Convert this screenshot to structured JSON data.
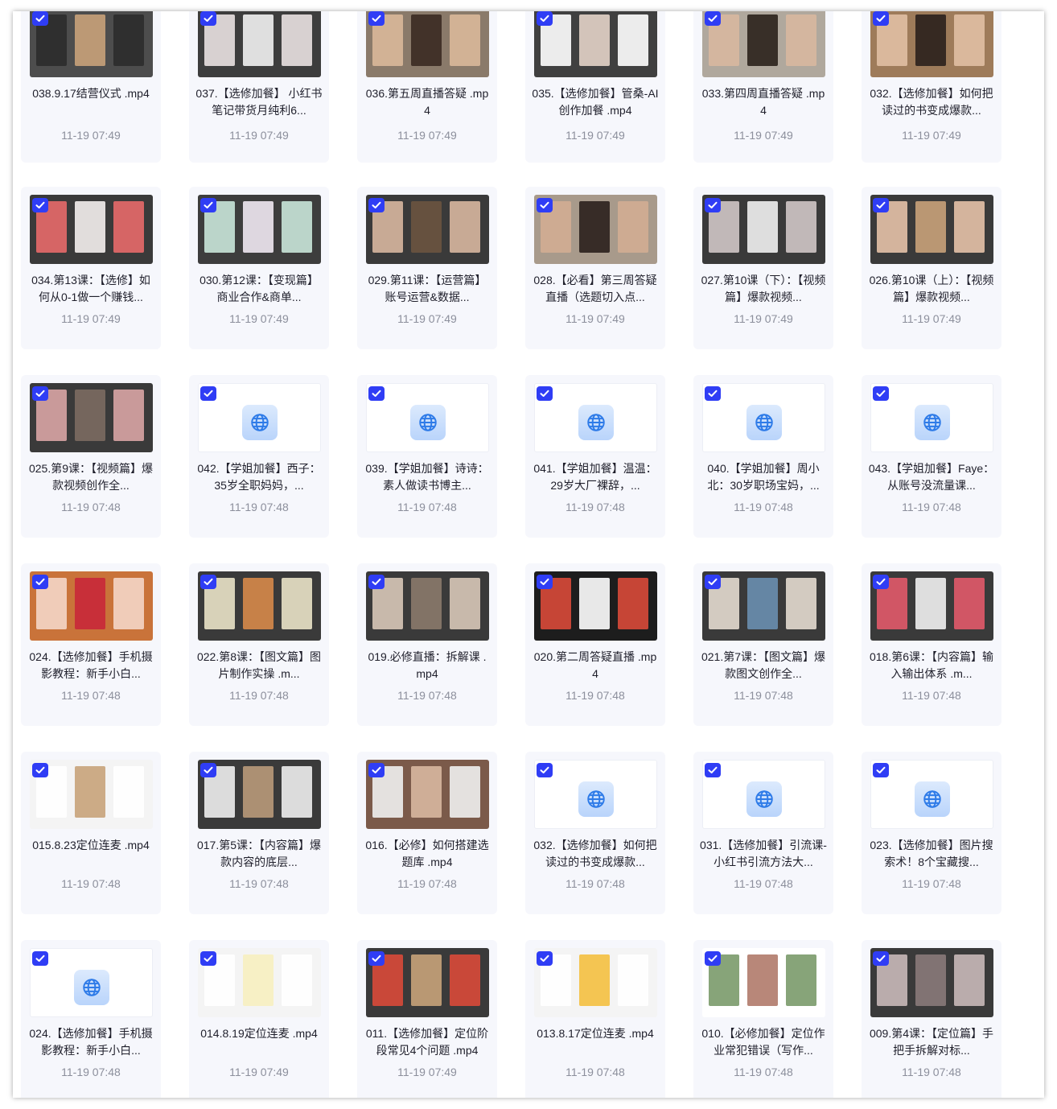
{
  "files": [
    {
      "title": "038.9.17结营仪式 .mp4",
      "time": "11-19 07:49",
      "kind": "video",
      "palette": [
        "#4d4d4d",
        "#c9a27a",
        "#2c2c2c"
      ]
    },
    {
      "title": "037.【选修加餐】 小红书笔记带货月纯利6...",
      "time": "11-19 07:49",
      "kind": "video",
      "palette": [
        "#3d3d3d",
        "#f1f1f1",
        "#e9e1e1"
      ]
    },
    {
      "title": "036.第五周直播答疑 .mp4",
      "time": "11-19 07:49",
      "kind": "video",
      "palette": [
        "#8a7a6a",
        "#3a2a22",
        "#d9b89a"
      ]
    },
    {
      "title": "035.【选修加餐】管桑-AI创作加餐 .mp4",
      "time": "11-19 07:49",
      "kind": "video",
      "palette": [
        "#404040",
        "#e3d3c8",
        "#ffffff"
      ]
    },
    {
      "title": "033.第四周直播答疑 .mp4",
      "time": "11-19 07:49",
      "kind": "video",
      "palette": [
        "#b0a89d",
        "#2b211c",
        "#d8b7a0"
      ]
    },
    {
      "title": "032.【选修加餐】如何把读过的书变成爆款...",
      "time": "11-19 07:49",
      "kind": "video",
      "palette": [
        "#9e7b5a",
        "#2a201c",
        "#e0bfa3"
      ]
    },
    {
      "title": "034.第13课：【选修】如何从0-1做一个赚钱...",
      "time": "11-19 07:49",
      "kind": "video",
      "palette": [
        "#3a3a3a",
        "#f4f0ee",
        "#e86a6a"
      ]
    },
    {
      "title": "030.第12课：【变现篇】商业合作&商单...",
      "time": "11-19 07:49",
      "kind": "video",
      "palette": [
        "#3d3d3d",
        "#f0e8f2",
        "#c9e6d9"
      ]
    },
    {
      "title": "029.第11课：【运营篇】账号运营&数据...",
      "time": "11-19 07:49",
      "kind": "video",
      "palette": [
        "#3a3a3a",
        "#6b5440",
        "#d8b7a0"
      ]
    },
    {
      "title": "028.【必看】第三周答疑直播（选题切入点...",
      "time": "11-19 07:49",
      "kind": "video",
      "palette": [
        "#a89a8b",
        "#2a201c",
        "#d2ad92"
      ]
    },
    {
      "title": "027.第10课（下）：【视频篇】爆款视频...",
      "time": "11-19 07:49",
      "kind": "video",
      "palette": [
        "#3a3a3a",
        "#f1f1f1",
        "#d0c6c6"
      ]
    },
    {
      "title": "026.第10课（上）：【视频篇】爆款视频...",
      "time": "11-19 07:49",
      "kind": "video",
      "palette": [
        "#3a3a3a",
        "#c9a27a",
        "#e5c2a8"
      ]
    },
    {
      "title": "025.第9课：【视频篇】爆款视频创作全...",
      "time": "11-19 07:48",
      "kind": "video",
      "palette": [
        "#3a3a3a",
        "#7c6b62",
        "#d9a5a5"
      ]
    },
    {
      "title": "042.【学姐加餐】西子：35岁全职妈妈，...",
      "time": "11-19 07:48",
      "kind": "link"
    },
    {
      "title": "039.【学姐加餐】诗诗：素人做读书博主...",
      "time": "11-19 07:48",
      "kind": "link"
    },
    {
      "title": "041.【学姐加餐】温温：29岁大厂裸辞，...",
      "time": "11-19 07:48",
      "kind": "link"
    },
    {
      "title": "040.【学姐加餐】周小北：30岁职场宝妈，...",
      "time": "11-19 07:48",
      "kind": "link"
    },
    {
      "title": "043.【学姐加餐】Faye：从账号没流量课...",
      "time": "11-19 07:48",
      "kind": "link"
    },
    {
      "title": "024.【选修加餐】手机摄影教程：新手小白...",
      "time": "11-19 07:48",
      "kind": "video",
      "palette": [
        "#c9733a",
        "#c8283a",
        "#f4d6c8"
      ]
    },
    {
      "title": "022.第8课：【图文篇】图片制作实操 .m...",
      "time": "11-19 07:48",
      "kind": "video",
      "palette": [
        "#3a3a3a",
        "#d78a4a",
        "#eae3c8"
      ]
    },
    {
      "title": "019.必修直播：拆解课 .mp4",
      "time": "11-19 07:48",
      "kind": "video",
      "palette": [
        "#3a3a3a",
        "#8b7a6b",
        "#d8c8b8"
      ]
    },
    {
      "title": "020.第二周答疑直播 .mp4",
      "time": "11-19 07:48",
      "kind": "video",
      "palette": [
        "#1d1d1d",
        "#ffffff",
        "#d94a3a"
      ]
    },
    {
      "title": "021.第7课：【图文篇】爆款图文创作全...",
      "time": "11-19 07:48",
      "kind": "video",
      "palette": [
        "#3a3a3a",
        "#6a8fb0",
        "#e4dcd0"
      ]
    },
    {
      "title": "018.第6课：【内容篇】输入输出体系 .m...",
      "time": "11-19 07:48",
      "kind": "video",
      "palette": [
        "#3a3a3a",
        "#f1f1f1",
        "#e25a6a"
      ]
    },
    {
      "title": "015.8.23定位连麦 .mp4",
      "time": "11-19 07:48",
      "kind": "video",
      "palette": [
        "#f4f4f4",
        "#c8a37a",
        "#ffffff"
      ]
    },
    {
      "title": "017.第5课：【内容篇】爆款内容的底层...",
      "time": "11-19 07:48",
      "kind": "video",
      "palette": [
        "#3a3a3a",
        "#b99a7a",
        "#eeeeee"
      ]
    },
    {
      "title": "016.【必修】如何搭建选题库 .mp4",
      "time": "11-19 07:48",
      "kind": "video",
      "palette": [
        "#7b5a4a",
        "#d8b7a0",
        "#f0f0f0"
      ]
    },
    {
      "title": "032.【选修加餐】如何把读过的书变成爆款...",
      "time": "11-19 07:48",
      "kind": "link"
    },
    {
      "title": "031.【选修加餐】引流课-小红书引流方法大...",
      "time": "11-19 07:48",
      "kind": "link"
    },
    {
      "title": "023.【选修加餐】图片搜索术！8个宝藏搜...",
      "time": "11-19 07:48",
      "kind": "link"
    },
    {
      "title": "024.【选修加餐】手机摄影教程：新手小白...",
      "time": "11-19 07:48",
      "kind": "link"
    },
    {
      "title": "014.8.19定位连麦 .mp4",
      "time": "11-19 07:49",
      "kind": "video",
      "palette": [
        "#f4f4f4",
        "#f7efc0",
        "#ffffff"
      ]
    },
    {
      "title": "011.【选修加餐】定位阶段常见4个问题 .mp4",
      "time": "11-19 07:49",
      "kind": "video",
      "palette": [
        "#3a3a3a",
        "#c8a37a",
        "#d94a3a"
      ]
    },
    {
      "title": "013.8.17定位连麦 .mp4",
      "time": "11-19 07:48",
      "kind": "video",
      "palette": [
        "#f4f4f4",
        "#f4c040",
        "#ffffff"
      ]
    },
    {
      "title": "010.【必修加餐】定位作业常犯错误（写作...",
      "time": "11-19 07:48",
      "kind": "video",
      "palette": [
        "#ffffff",
        "#b07a6a",
        "#7a9a6a"
      ]
    },
    {
      "title": "009.第4课：【定位篇】手把手拆解对标...",
      "time": "11-19 07:48",
      "kind": "video",
      "palette": [
        "#3a3a3a",
        "#8a7a7a",
        "#c9b9b9"
      ]
    }
  ],
  "colors": {
    "card_bg": "#f6f7fc",
    "checkbox": "#2f3df5",
    "title_text": "#1f1f2b",
    "time_text": "#8c8f9c",
    "globe_icon": "#2e7be8"
  },
  "icons": {
    "checkbox": "checkbox-checked-icon",
    "link": "globe-icon"
  }
}
